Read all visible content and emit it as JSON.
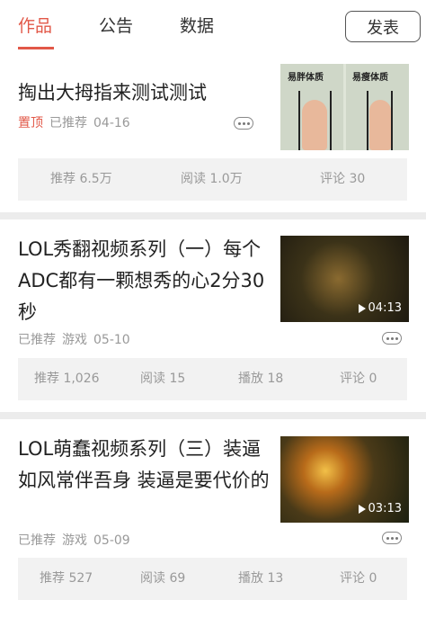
{
  "tabs": [
    {
      "label": "作品",
      "active": true
    },
    {
      "label": "公告",
      "active": false
    },
    {
      "label": "数据",
      "active": false
    }
  ],
  "publish_label": "发表",
  "colors": {
    "accent": "#e25848",
    "divider": "#ececec",
    "stats_bg": "#f2f2f2"
  },
  "articles": [
    {
      "title": "掏出大拇指来测试测试",
      "pinned": "置顶",
      "recommended": "已推荐",
      "date": "04-16",
      "thumbnail": {
        "type": "image",
        "labels": [
          "易胖体质",
          "易瘦体质"
        ]
      },
      "stats": {
        "recommend": "推荐 6.5万",
        "read": "阅读 1.0万",
        "comment": "评论 30"
      }
    },
    {
      "title": "LOL秀翻视频系列（一）每个ADC都有一颗想秀的心2分30秒",
      "recommended": "已推荐",
      "category": "游戏",
      "date": "05-10",
      "thumbnail": {
        "type": "video",
        "duration": "04:13"
      },
      "stats": {
        "recommend": "推荐 1,026",
        "read": "阅读 15",
        "play": "播放 18",
        "comment": "评论 0"
      }
    },
    {
      "title": "LOL萌蠢视频系列（三）装逼如风常伴吾身 装逼是要代价的",
      "recommended": "已推荐",
      "category": "游戏",
      "date": "05-09",
      "thumbnail": {
        "type": "video",
        "duration": "03:13"
      },
      "stats": {
        "recommend": "推荐 527",
        "read": "阅读 69",
        "play": "播放 13",
        "comment": "评论 0"
      }
    }
  ]
}
